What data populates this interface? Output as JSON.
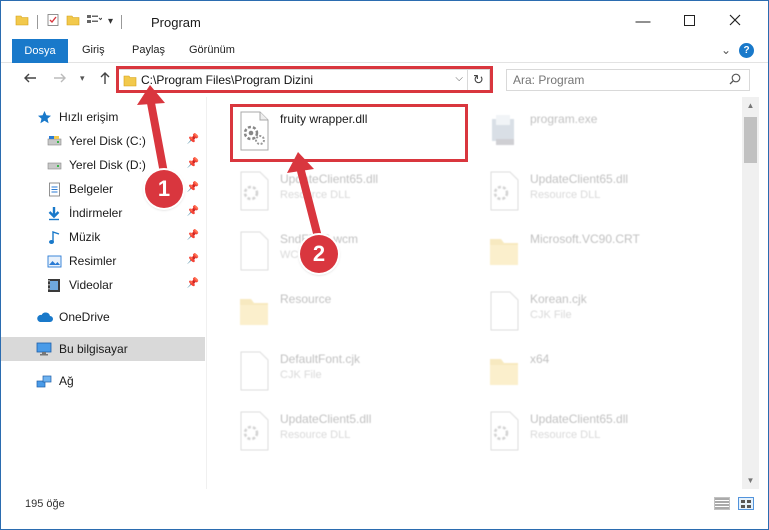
{
  "window": {
    "title": "Program",
    "accent": "#1979ca",
    "highlight": "#d9363e"
  },
  "ribbon": {
    "file_tab": "Dosya",
    "tabs": [
      "Giriş",
      "Paylaş",
      "Görünüm"
    ],
    "help_label": "?"
  },
  "address": {
    "path": "C:\\Program Files\\Program Dizini"
  },
  "search": {
    "placeholder": "Ara: Program"
  },
  "sidebar": {
    "items": [
      {
        "label": "Hızlı erişim",
        "icon": "star-icon"
      },
      {
        "label": "Yerel Disk (C:)",
        "icon": "drive-icon",
        "pinned": true
      },
      {
        "label": "Yerel Disk (D:)",
        "icon": "drive-icon",
        "pinned": true
      },
      {
        "label": "Belgeler",
        "icon": "documents-icon",
        "pinned": true
      },
      {
        "label": "İndirmeler",
        "icon": "download-icon",
        "pinned": true
      },
      {
        "label": "Müzik",
        "icon": "music-icon",
        "pinned": true
      },
      {
        "label": "Resimler",
        "icon": "pictures-icon",
        "pinned": true
      },
      {
        "label": "Videolar",
        "icon": "videos-icon",
        "pinned": true
      },
      {
        "label": "OneDrive",
        "icon": "cloud-icon"
      },
      {
        "label": "Bu bilgisayar",
        "icon": "computer-icon",
        "selected": true
      },
      {
        "label": "Ağ",
        "icon": "network-icon"
      }
    ]
  },
  "files": [
    {
      "name": "fruity wrapper.dll",
      "type": "",
      "icon": "dll-icon"
    },
    {
      "name": "program.exe",
      "type": "",
      "icon": "exe-icon"
    },
    {
      "name": "UpdateClient65.dll",
      "type": "Resource DLL",
      "icon": "dll-icon"
    },
    {
      "name": "UpdateClient65.dll",
      "type": "Resource DLL",
      "icon": "dll-icon"
    },
    {
      "name": "SndFP96.wcm",
      "type": "WCM",
      "icon": "file-icon"
    },
    {
      "name": "Microsoft.VC90.CRT",
      "type": "",
      "icon": "folder-icon"
    },
    {
      "name": "Resource",
      "type": "",
      "icon": "folder-icon"
    },
    {
      "name": "Korean.cjk",
      "type": "CJK File",
      "icon": "file-icon"
    },
    {
      "name": "DefaultFont.cjk",
      "type": "CJK File",
      "icon": "file-icon"
    },
    {
      "name": "x64",
      "type": "",
      "icon": "folder-icon"
    },
    {
      "name": "UpdateClient5.dll",
      "type": "Resource DLL",
      "icon": "dll-icon"
    },
    {
      "name": "UpdateClient65.dll",
      "type": "Resource DLL",
      "icon": "dll-icon"
    }
  ],
  "status": {
    "count": "195 öğe"
  },
  "callouts": {
    "one": "1",
    "two": "2"
  }
}
